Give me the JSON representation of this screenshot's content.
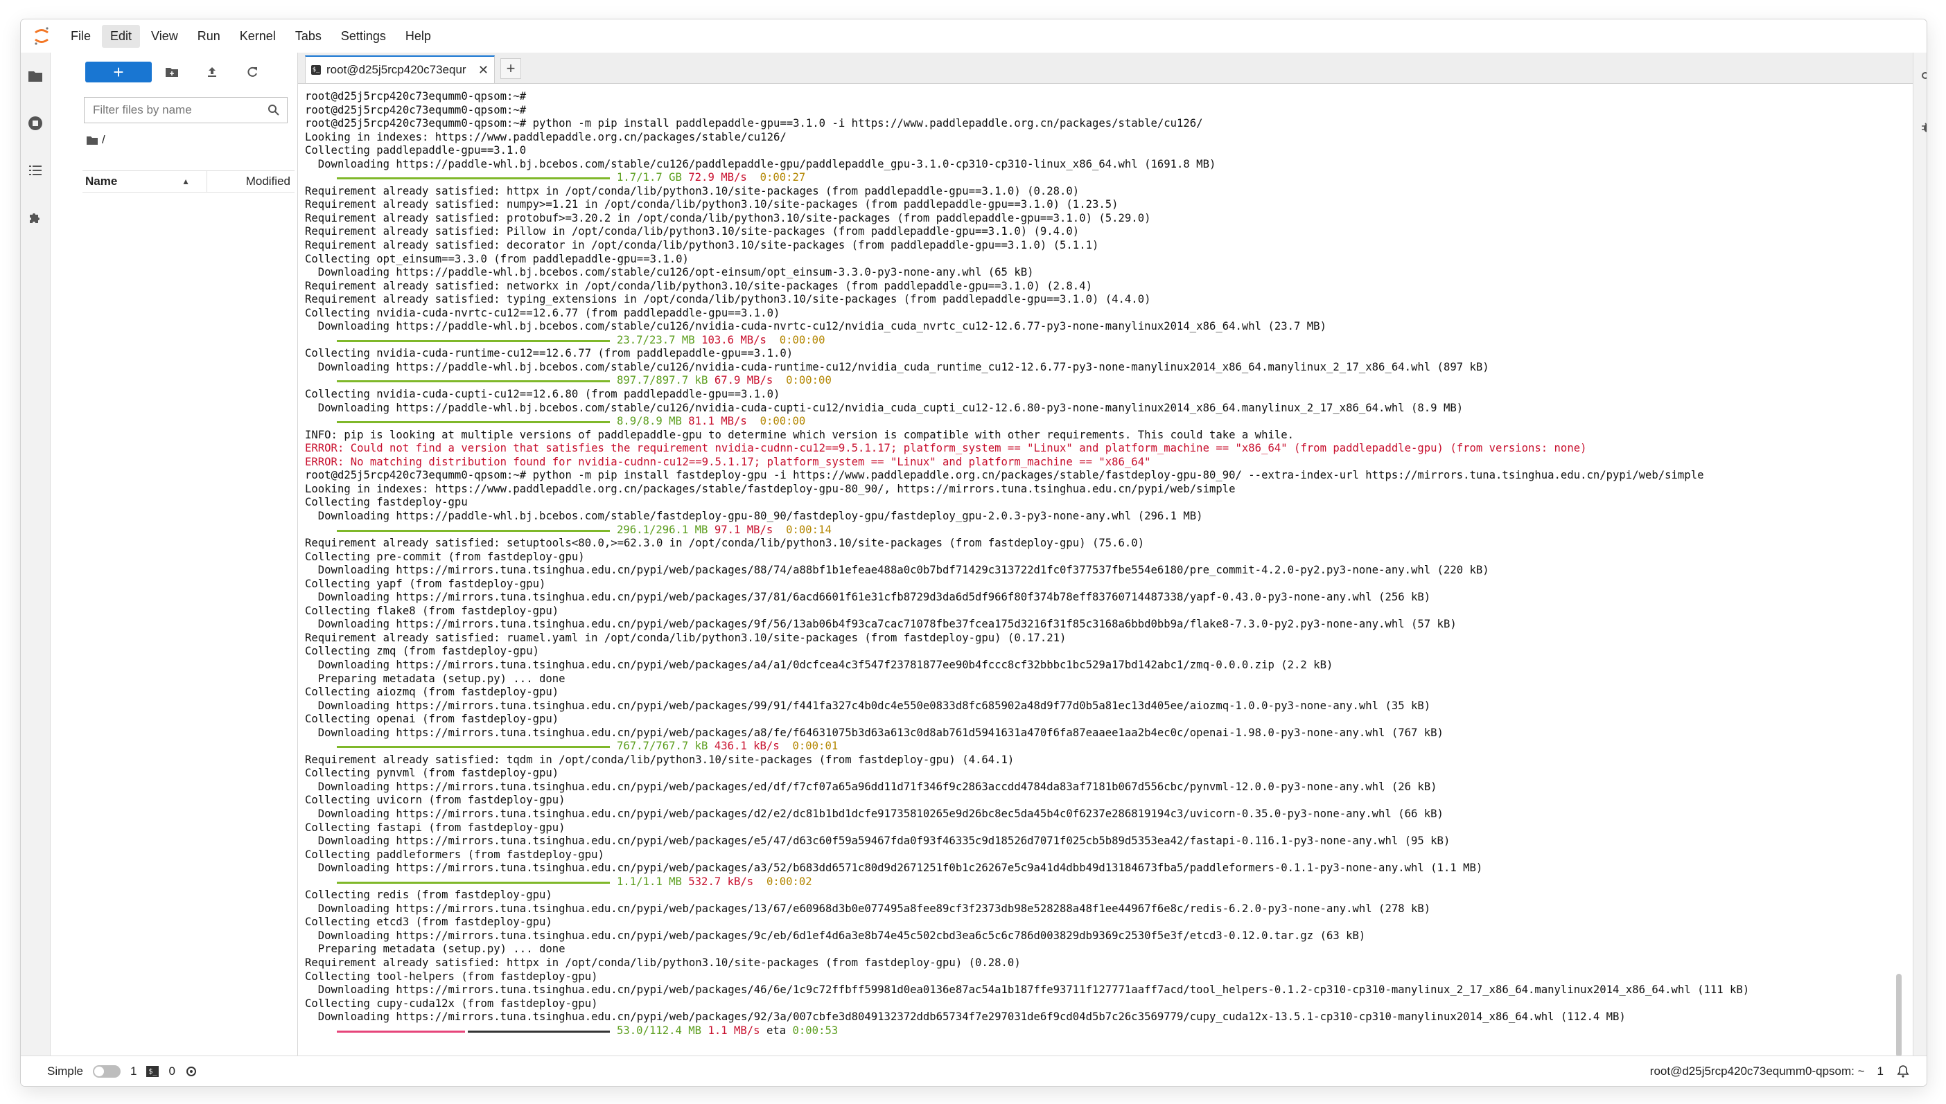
{
  "menubar": {
    "items": [
      "File",
      "Edit",
      "View",
      "Run",
      "Kernel",
      "Tabs",
      "Settings",
      "Help"
    ]
  },
  "filebrowser": {
    "new_label": "+",
    "search_placeholder": "Filter files by name",
    "breadcrumb": "/",
    "col_name": "Name",
    "col_modified": "Modified"
  },
  "tab": {
    "title": "root@d25j5rcp420c73equr",
    "close": "✕",
    "add": "+"
  },
  "terminal": {
    "lines": [
      {
        "t": "text",
        "v": "root@d25j5rcp420c73equmm0-qpsom:~#"
      },
      {
        "t": "text",
        "v": "root@d25j5rcp420c73equmm0-qpsom:~#"
      },
      {
        "t": "text",
        "v": "root@d25j5rcp420c73equmm0-qpsom:~# python -m pip install paddlepaddle-gpu==3.1.0 -i https://www.paddlepaddle.org.cn/packages/stable/cu126/"
      },
      {
        "t": "text",
        "v": "Looking in indexes: https://www.paddlepaddle.org.cn/packages/stable/cu126/"
      },
      {
        "t": "text",
        "v": "Collecting paddlepaddle-gpu==3.1.0"
      },
      {
        "t": "text",
        "v": "  Downloading https://paddle-whl.bj.bcebos.com/stable/cu126/paddlepaddle-gpu/paddlepaddle_gpu-3.1.0-cp310-cp310-linux_x86_64.whl (1691.8 MB)"
      },
      {
        "t": "bar",
        "size": "1.7/1.7 GB",
        "speed": "72.9 MB/s",
        "time": "0:00:27",
        "fill": 1
      },
      {
        "t": "text",
        "v": "Requirement already satisfied: httpx in /opt/conda/lib/python3.10/site-packages (from paddlepaddle-gpu==3.1.0) (0.28.0)"
      },
      {
        "t": "text",
        "v": "Requirement already satisfied: numpy>=1.21 in /opt/conda/lib/python3.10/site-packages (from paddlepaddle-gpu==3.1.0) (1.23.5)"
      },
      {
        "t": "text",
        "v": "Requirement already satisfied: protobuf>=3.20.2 in /opt/conda/lib/python3.10/site-packages (from paddlepaddle-gpu==3.1.0) (5.29.0)"
      },
      {
        "t": "text",
        "v": "Requirement already satisfied: Pillow in /opt/conda/lib/python3.10/site-packages (from paddlepaddle-gpu==3.1.0) (9.4.0)"
      },
      {
        "t": "text",
        "v": "Requirement already satisfied: decorator in /opt/conda/lib/python3.10/site-packages (from paddlepaddle-gpu==3.1.0) (5.1.1)"
      },
      {
        "t": "text",
        "v": "Collecting opt_einsum==3.3.0 (from paddlepaddle-gpu==3.1.0)"
      },
      {
        "t": "text",
        "v": "  Downloading https://paddle-whl.bj.bcebos.com/stable/cu126/opt-einsum/opt_einsum-3.3.0-py3-none-any.whl (65 kB)"
      },
      {
        "t": "text",
        "v": "Requirement already satisfied: networkx in /opt/conda/lib/python3.10/site-packages (from paddlepaddle-gpu==3.1.0) (2.8.4)"
      },
      {
        "t": "text",
        "v": "Requirement already satisfied: typing_extensions in /opt/conda/lib/python3.10/site-packages (from paddlepaddle-gpu==3.1.0) (4.4.0)"
      },
      {
        "t": "text",
        "v": "Collecting nvidia-cuda-nvrtc-cu12==12.6.77 (from paddlepaddle-gpu==3.1.0)"
      },
      {
        "t": "text",
        "v": "  Downloading https://paddle-whl.bj.bcebos.com/stable/cu126/nvidia-cuda-nvrtc-cu12/nvidia_cuda_nvrtc_cu12-12.6.77-py3-none-manylinux2014_x86_64.whl (23.7 MB)"
      },
      {
        "t": "bar",
        "size": "23.7/23.7 MB",
        "speed": "103.6 MB/s",
        "time": "0:00:00",
        "fill": 1
      },
      {
        "t": "text",
        "v": "Collecting nvidia-cuda-runtime-cu12==12.6.77 (from paddlepaddle-gpu==3.1.0)"
      },
      {
        "t": "text",
        "v": "  Downloading https://paddle-whl.bj.bcebos.com/stable/cu126/nvidia-cuda-runtime-cu12/nvidia_cuda_runtime_cu12-12.6.77-py3-none-manylinux2014_x86_64.manylinux_2_17_x86_64.whl (897 kB)"
      },
      {
        "t": "bar",
        "size": "897.7/897.7 kB",
        "speed": "67.9 MB/s",
        "time": "0:00:00",
        "fill": 1
      },
      {
        "t": "text",
        "v": "Collecting nvidia-cuda-cupti-cu12==12.6.80 (from paddlepaddle-gpu==3.1.0)"
      },
      {
        "t": "text",
        "v": "  Downloading https://paddle-whl.bj.bcebos.com/stable/cu126/nvidia-cuda-cupti-cu12/nvidia_cuda_cupti_cu12-12.6.80-py3-none-manylinux2014_x86_64.manylinux_2_17_x86_64.whl (8.9 MB)"
      },
      {
        "t": "bar",
        "size": "8.9/8.9 MB",
        "speed": "81.1 MB/s",
        "time": "0:00:00",
        "fill": 1
      },
      {
        "t": "text",
        "v": "INFO: pip is looking at multiple versions of paddlepaddle-gpu to determine which version is compatible with other requirements. This could take a while."
      },
      {
        "t": "err",
        "v": "ERROR: Could not find a version that satisfies the requirement nvidia-cudnn-cu12==9.5.1.17; platform_system == \"Linux\" and platform_machine == \"x86_64\" (from paddlepaddle-gpu) (from versions: none)"
      },
      {
        "t": "err",
        "v": "ERROR: No matching distribution found for nvidia-cudnn-cu12==9.5.1.17; platform_system == \"Linux\" and platform_machine == \"x86_64\""
      },
      {
        "t": "text",
        "v": "root@d25j5rcp420c73equmm0-qpsom:~# python -m pip install fastdeploy-gpu -i https://www.paddlepaddle.org.cn/packages/stable/fastdeploy-gpu-80_90/ --extra-index-url https://mirrors.tuna.tsinghua.edu.cn/pypi/web/simple"
      },
      {
        "t": "text",
        "v": "Looking in indexes: https://www.paddlepaddle.org.cn/packages/stable/fastdeploy-gpu-80_90/, https://mirrors.tuna.tsinghua.edu.cn/pypi/web/simple"
      },
      {
        "t": "text",
        "v": "Collecting fastdeploy-gpu"
      },
      {
        "t": "text",
        "v": "  Downloading https://paddle-whl.bj.bcebos.com/stable/fastdeploy-gpu-80_90/fastdeploy-gpu/fastdeploy_gpu-2.0.3-py3-none-any.whl (296.1 MB)"
      },
      {
        "t": "bar",
        "size": "296.1/296.1 MB",
        "speed": "97.1 MB/s",
        "time": "0:00:14",
        "fill": 1
      },
      {
        "t": "text",
        "v": "Requirement already satisfied: setuptools<80.0,>=62.3.0 in /opt/conda/lib/python3.10/site-packages (from fastdeploy-gpu) (75.6.0)"
      },
      {
        "t": "text",
        "v": "Collecting pre-commit (from fastdeploy-gpu)"
      },
      {
        "t": "text",
        "v": "  Downloading https://mirrors.tuna.tsinghua.edu.cn/pypi/web/packages/88/74/a88bf1b1efeae488a0c0b7bdf71429c313722d1fc0f377537fbe554e6180/pre_commit-4.2.0-py2.py3-none-any.whl (220 kB)"
      },
      {
        "t": "text",
        "v": "Collecting yapf (from fastdeploy-gpu)"
      },
      {
        "t": "text",
        "v": "  Downloading https://mirrors.tuna.tsinghua.edu.cn/pypi/web/packages/37/81/6acd6601f61e31cfb8729d3da6d5df966f80f374b78eff83760714487338/yapf-0.43.0-py3-none-any.whl (256 kB)"
      },
      {
        "t": "text",
        "v": "Collecting flake8 (from fastdeploy-gpu)"
      },
      {
        "t": "text",
        "v": "  Downloading https://mirrors.tuna.tsinghua.edu.cn/pypi/web/packages/9f/56/13ab06b4f93ca7cac71078fbe37fcea175d3216f31f85c3168a6bbd0bb9a/flake8-7.3.0-py2.py3-none-any.whl (57 kB)"
      },
      {
        "t": "text",
        "v": "Requirement already satisfied: ruamel.yaml in /opt/conda/lib/python3.10/site-packages (from fastdeploy-gpu) (0.17.21)"
      },
      {
        "t": "text",
        "v": "Collecting zmq (from fastdeploy-gpu)"
      },
      {
        "t": "text",
        "v": "  Downloading https://mirrors.tuna.tsinghua.edu.cn/pypi/web/packages/a4/a1/0dcfcea4c3f547f23781877ee90b4fccc8cf32bbbc1bc529a17bd142abc1/zmq-0.0.0.zip (2.2 kB)"
      },
      {
        "t": "text",
        "v": "  Preparing metadata (setup.py) ... done"
      },
      {
        "t": "text",
        "v": "Collecting aiozmq (from fastdeploy-gpu)"
      },
      {
        "t": "text",
        "v": "  Downloading https://mirrors.tuna.tsinghua.edu.cn/pypi/web/packages/99/91/f441fa327c4b0dc4e550e0833d8fc685902a48d9f77d0b5a81ec13d405ee/aiozmq-1.0.0-py3-none-any.whl (35 kB)"
      },
      {
        "t": "text",
        "v": "Collecting openai (from fastdeploy-gpu)"
      },
      {
        "t": "text",
        "v": "  Downloading https://mirrors.tuna.tsinghua.edu.cn/pypi/web/packages/a8/fe/f64631075b3d63a613c0d8ab761d5941631a470f6fa87eaaee1aa2b4ec0c/openai-1.98.0-py3-none-any.whl (767 kB)"
      },
      {
        "t": "bar",
        "size": "767.7/767.7 kB",
        "speed": "436.1 kB/s",
        "time": "0:00:01",
        "fill": 1
      },
      {
        "t": "text",
        "v": "Requirement already satisfied: tqdm in /opt/conda/lib/python3.10/site-packages (from fastdeploy-gpu) (4.64.1)"
      },
      {
        "t": "text",
        "v": "Collecting pynvml (from fastdeploy-gpu)"
      },
      {
        "t": "text",
        "v": "  Downloading https://mirrors.tuna.tsinghua.edu.cn/pypi/web/packages/ed/df/f7cf07a65a96dd11d71f346f9c2863accdd4784da83af7181b067d556cbc/pynvml-12.0.0-py3-none-any.whl (26 kB)"
      },
      {
        "t": "text",
        "v": "Collecting uvicorn (from fastdeploy-gpu)"
      },
      {
        "t": "text",
        "v": "  Downloading https://mirrors.tuna.tsinghua.edu.cn/pypi/web/packages/d2/e2/dc81b1bd1dcfe91735810265e9d26bc8ec5da45b4c0f6237e286819194c3/uvicorn-0.35.0-py3-none-any.whl (66 kB)"
      },
      {
        "t": "text",
        "v": "Collecting fastapi (from fastdeploy-gpu)"
      },
      {
        "t": "text",
        "v": "  Downloading https://mirrors.tuna.tsinghua.edu.cn/pypi/web/packages/e5/47/d63c60f59a59467fda0f93f46335c9d18526d7071f025cb5b89d5353ea42/fastapi-0.116.1-py3-none-any.whl (95 kB)"
      },
      {
        "t": "text",
        "v": "Collecting paddleformers (from fastdeploy-gpu)"
      },
      {
        "t": "text",
        "v": "  Downloading https://mirrors.tuna.tsinghua.edu.cn/pypi/web/packages/a3/52/b683dd6571c80d9d2671251f0b1c26267e5c9a41d4dbb49d13184673fba5/paddleformers-0.1.1-py3-none-any.whl (1.1 MB)"
      },
      {
        "t": "bar",
        "size": "1.1/1.1 MB",
        "speed": "532.7 kB/s",
        "time": "0:00:02",
        "fill": 1
      },
      {
        "t": "text",
        "v": "Collecting redis (from fastdeploy-gpu)"
      },
      {
        "t": "text",
        "v": "  Downloading https://mirrors.tuna.tsinghua.edu.cn/pypi/web/packages/13/67/e60968d3b0e077495a8fee89cf3f2373db98e528288a48f1ee44967f6e8c/redis-6.2.0-py3-none-any.whl (278 kB)"
      },
      {
        "t": "text",
        "v": "Collecting etcd3 (from fastdeploy-gpu)"
      },
      {
        "t": "text",
        "v": "  Downloading https://mirrors.tuna.tsinghua.edu.cn/pypi/web/packages/9c/eb/6d1ef4d6a3e8b74e45c502cbd3ea6c5c6c786d003829db9369c2530f5e3f/etcd3-0.12.0.tar.gz (63 kB)"
      },
      {
        "t": "text",
        "v": "  Preparing metadata (setup.py) ... done"
      },
      {
        "t": "text",
        "v": "Requirement already satisfied: httpx in /opt/conda/lib/python3.10/site-packages (from fastdeploy-gpu) (0.28.0)"
      },
      {
        "t": "text",
        "v": "Collecting tool-helpers (from fastdeploy-gpu)"
      },
      {
        "t": "text",
        "v": "  Downloading https://mirrors.tuna.tsinghua.edu.cn/pypi/web/packages/46/6e/1c9c72ffbff59981d0ea0136e87ac54a1b187ffe93711f127771aaff7acd/tool_helpers-0.1.2-cp310-cp310-manylinux_2_17_x86_64.manylinux2014_x86_64.whl (111 kB)"
      },
      {
        "t": "text",
        "v": "Collecting cupy-cuda12x (from fastdeploy-gpu)"
      },
      {
        "t": "text",
        "v": "  Downloading https://mirrors.tuna.tsinghua.edu.cn/pypi/web/packages/92/3a/007cbfe3d8049132372ddb65734f7e297031de6f9cd04d5b7c26c3569779/cupy_cuda12x-13.5.1-cp310-cp310-manylinux2014_x86_64.whl (112.4 MB)"
      },
      {
        "t": "bar",
        "size": "53.0/112.4 MB",
        "speed": "1.1 MB/s",
        "time": "0:00:53",
        "eta": "eta",
        "fill": 0.47
      }
    ]
  },
  "statusbar": {
    "mode_label": "Simple",
    "terminals_count": "1",
    "kernels_count": "0",
    "right_title": "root@d25j5rcp420c73equmm0-qpsom: ~",
    "right_count": "1"
  }
}
